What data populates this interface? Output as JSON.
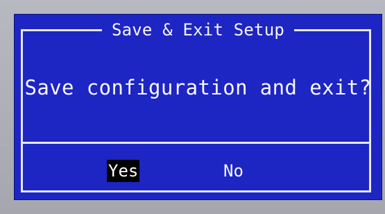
{
  "dialog": {
    "title": "Save & Exit Setup",
    "prompt": "Save configuration and exit?",
    "options": [
      {
        "label": "Yes",
        "selected": true
      },
      {
        "label": "No",
        "selected": false
      }
    ]
  },
  "colors": {
    "dialog_background": "#1d25c3",
    "border": "#e5e8ff",
    "text": "#f7f8ff",
    "selected_background": "#000000",
    "selected_text": "#ffffff",
    "outer_background": "#a9a9ae"
  }
}
